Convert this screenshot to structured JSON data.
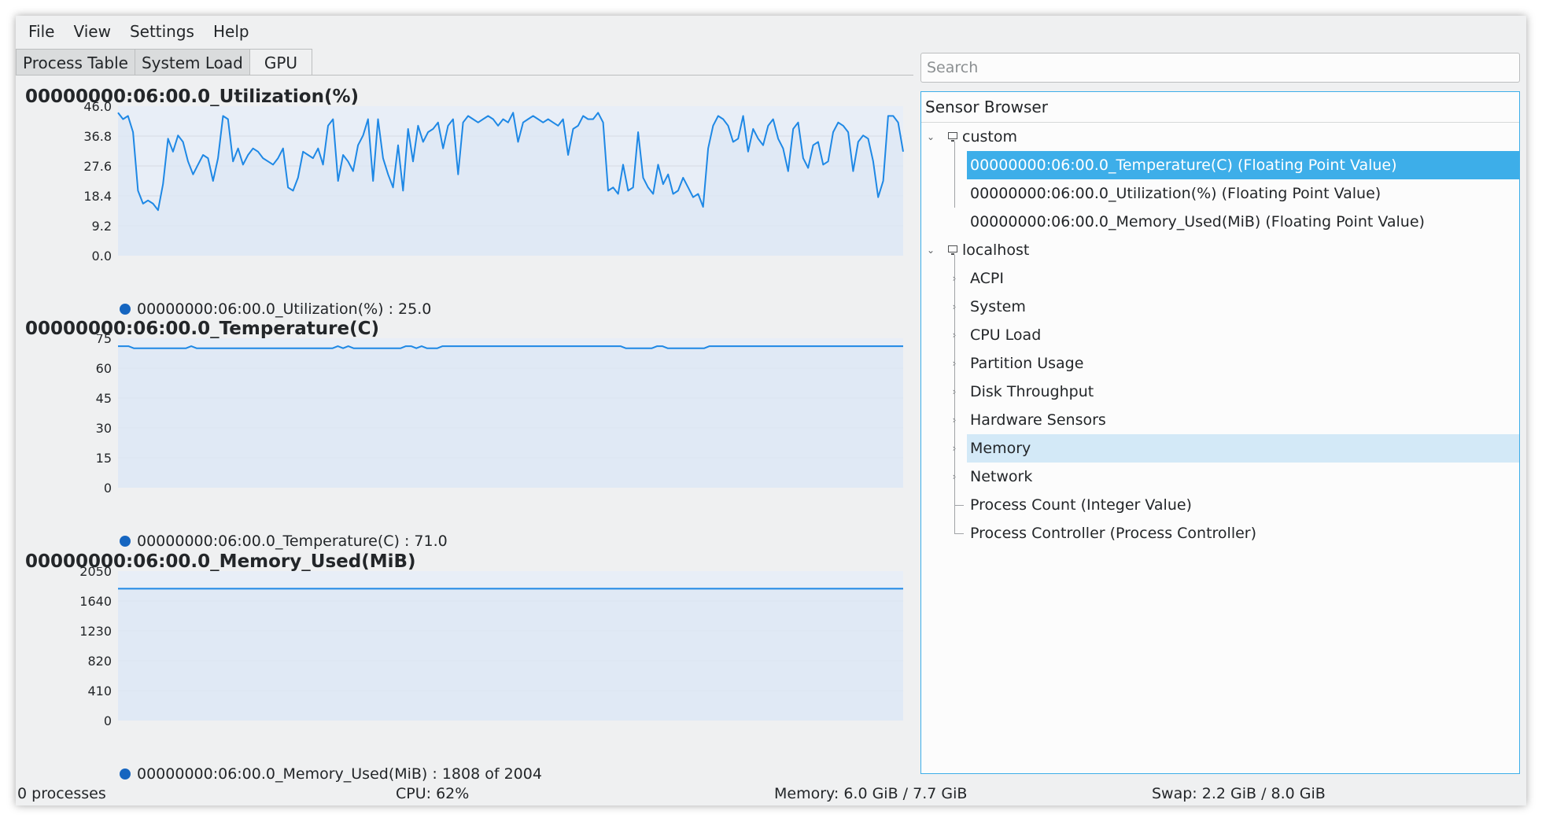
{
  "menu": [
    "File",
    "View",
    "Settings",
    "Help"
  ],
  "tabs": [
    "Process Table",
    "System Load",
    "GPU"
  ],
  "colors": {
    "accent": "#3daee9",
    "series": "#1e88e5",
    "series_dot": "#1565c0",
    "plot_fill": "#e8eef7"
  },
  "charts": [
    {
      "title": "00000000:06:00.0_Utilization(%)",
      "legend": "00000000:06:00.0_Utilization(%) : 25.0",
      "ticks": [
        "46.0",
        "36.8",
        "27.6",
        "18.4",
        "9.2",
        "0.0"
      ]
    },
    {
      "title": "00000000:06:00.0_Temperature(C)",
      "legend": "00000000:06:00.0_Temperature(C) : 71.0",
      "ticks": [
        "75",
        "60",
        "45",
        "30",
        "15",
        "0"
      ]
    },
    {
      "title": "00000000:06:00.0_Memory_Used(MiB)",
      "legend": "00000000:06:00.0_Memory_Used(MiB) : 1808 of 2004",
      "ticks": [
        "2050",
        "1640",
        "1230",
        "820",
        "410",
        "0"
      ]
    }
  ],
  "chart_data": [
    {
      "type": "line",
      "title": "00000000:06:00.0_Utilization(%)",
      "ylim": [
        0,
        46
      ],
      "series": [
        {
          "name": "00000000:06:00.0_Utilization(%)",
          "values": [
            44,
            42,
            43,
            38,
            20,
            16,
            17,
            16,
            14,
            22,
            36,
            32,
            37,
            35,
            29,
            25,
            28,
            31,
            30,
            23,
            30,
            43,
            42,
            29,
            33,
            28,
            31,
            33,
            32,
            30,
            29,
            28,
            30,
            33,
            21,
            20,
            24,
            32,
            31,
            30,
            33,
            28,
            40,
            42,
            23,
            31,
            29,
            26,
            34,
            37,
            42,
            23,
            42,
            30,
            25,
            21,
            34,
            20,
            39,
            29,
            40,
            35,
            38,
            39,
            41,
            33,
            40,
            42,
            25,
            41,
            43,
            42,
            41,
            42,
            43,
            42,
            40,
            42,
            41,
            44,
            35,
            41,
            42,
            43,
            42,
            41,
            42,
            41,
            40,
            42,
            31,
            39,
            40,
            43,
            42,
            42,
            44,
            41,
            20,
            21,
            19,
            28,
            20,
            21,
            38,
            24,
            21,
            19,
            28,
            22,
            25,
            19,
            20,
            24,
            21,
            18,
            19,
            15,
            33,
            40,
            43,
            42,
            40,
            35,
            36,
            43,
            32,
            39,
            36,
            34,
            40,
            42,
            36,
            33,
            26,
            39,
            41,
            30,
            27,
            34,
            35,
            28,
            29,
            38,
            41,
            40,
            38,
            26,
            35,
            37,
            36,
            29,
            18,
            23,
            43,
            43,
            41,
            32
          ]
        }
      ]
    },
    {
      "type": "line",
      "title": "00000000:06:00.0_Temperature(C)",
      "ylim": [
        0,
        75
      ],
      "series": [
        {
          "name": "00000000:06:00.0_Temperature(C)",
          "values": [
            71,
            71,
            71,
            70,
            70,
            70,
            70,
            70,
            70,
            70,
            70,
            70,
            70,
            70,
            71,
            70,
            70,
            70,
            70,
            70,
            70,
            70,
            70,
            70,
            70,
            70,
            70,
            70,
            70,
            70,
            70,
            70,
            70,
            70,
            70,
            70,
            70,
            70,
            70,
            70,
            70,
            70,
            71,
            70,
            71,
            70,
            70,
            70,
            70,
            70,
            70,
            70,
            70,
            70,
            70,
            71,
            71,
            70,
            71,
            70,
            70,
            70,
            71,
            71,
            71,
            71,
            71,
            71,
            71,
            71,
            71,
            71,
            71,
            71,
            71,
            71,
            71,
            71,
            71,
            71,
            71,
            71,
            71,
            71,
            71,
            71,
            71,
            71,
            71,
            71,
            71,
            71,
            71,
            71,
            71,
            71,
            71,
            70,
            70,
            70,
            70,
            70,
            70,
            71,
            71,
            70,
            70,
            70,
            70,
            70,
            70,
            70,
            70,
            71,
            71,
            71,
            71,
            71,
            71,
            71,
            71,
            71,
            71,
            71,
            71,
            71,
            71,
            71,
            71,
            71,
            71,
            71,
            71,
            71,
            71,
            71,
            71,
            71,
            71,
            71,
            71,
            71,
            71,
            71,
            71,
            71,
            71,
            71,
            71,
            71,
            71
          ]
        }
      ]
    },
    {
      "type": "line",
      "title": "00000000:06:00.0_Memory_Used(MiB)",
      "ylim": [
        0,
        2050
      ],
      "series": [
        {
          "name": "00000000:06:00.0_Memory_Used(MiB)",
          "values": [
            1808,
            1808,
            1808,
            1808,
            1808,
            1808,
            1808,
            1808,
            1808,
            1808
          ]
        }
      ]
    }
  ],
  "search": {
    "placeholder": "Search"
  },
  "sensor_browser": {
    "title": "Sensor Browser",
    "custom": {
      "label": "custom",
      "items": [
        "00000000:06:00.0_Temperature(C) (Floating Point Value)",
        "00000000:06:00.0_Utilization(%) (Floating Point Value)",
        "00000000:06:00.0_Memory_Used(MiB) (Floating Point Value)"
      ]
    },
    "localhost": {
      "label": "localhost",
      "items": [
        "ACPI",
        "System",
        "CPU Load",
        "Partition Usage",
        "Disk Throughput",
        "Hardware Sensors",
        "Memory",
        "Network",
        "Process Count (Integer Value)",
        "Process Controller (Process Controller)"
      ]
    }
  },
  "status": {
    "processes": "0 processes",
    "cpu": "CPU: 62%",
    "memory": "Memory: 6.0 GiB / 7.7 GiB",
    "swap": "Swap: 2.2 GiB / 8.0 GiB"
  }
}
